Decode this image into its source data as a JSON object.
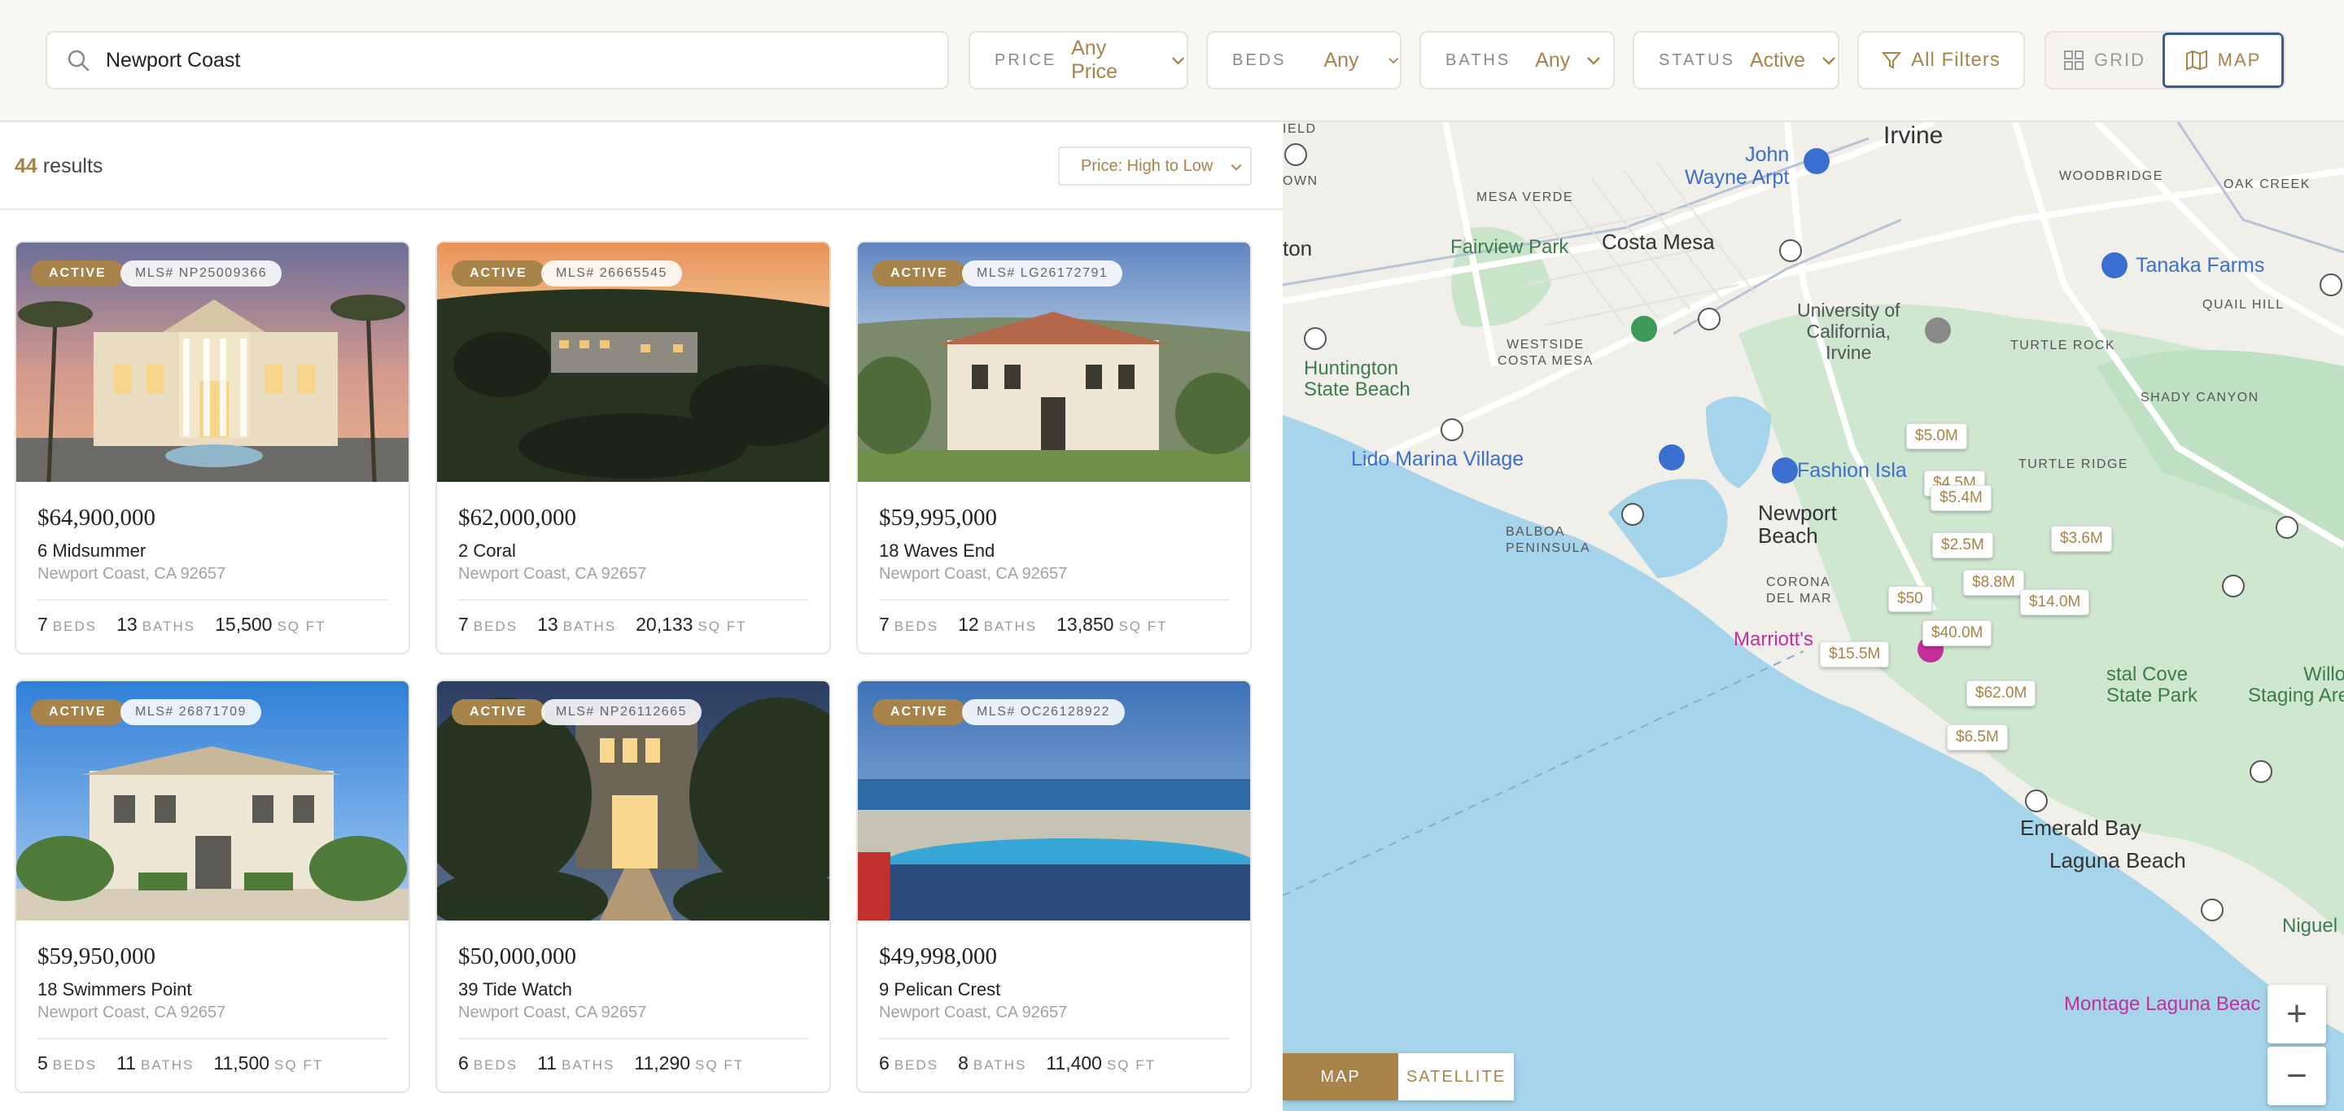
{
  "search": {
    "value": "Newport Coast"
  },
  "filters": {
    "price": {
      "label": "PRICE",
      "value": "Any Price"
    },
    "beds": {
      "label": "BEDS",
      "value": "Any"
    },
    "baths": {
      "label": "BATHS",
      "value": "Any"
    },
    "status": {
      "label": "STATUS",
      "value": "Active"
    },
    "all_filters": "All Filters"
  },
  "view_toggle": {
    "grid": "GRID",
    "map": "MAP",
    "selected": "MAP"
  },
  "results": {
    "count": "44",
    "label": "results",
    "sort": "Price: High to Low"
  },
  "listings": [
    {
      "status": "ACTIVE",
      "mls": "MLS# NP25009366",
      "price": "$64,900,000",
      "address": "6 Midsummer",
      "city": "Newport Coast, CA 92657",
      "beds": "7",
      "baths": "13",
      "sqft": "15,500"
    },
    {
      "status": "ACTIVE",
      "mls": "MLS# 26665545",
      "price": "$62,000,000",
      "address": "2 Coral",
      "city": "Newport Coast, CA 92657",
      "beds": "7",
      "baths": "13",
      "sqft": "20,133"
    },
    {
      "status": "ACTIVE",
      "mls": "MLS# LG26172791",
      "price": "$59,995,000",
      "address": "18 Waves End",
      "city": "Newport Coast, CA 92657",
      "beds": "7",
      "baths": "12",
      "sqft": "13,850"
    },
    {
      "status": "ACTIVE",
      "mls": "MLS# 26871709",
      "price": "$59,950,000",
      "address": "18 Swimmers Point",
      "city": "Newport Coast, CA 92657",
      "beds": "5",
      "baths": "11",
      "sqft": "11,500"
    },
    {
      "status": "ACTIVE",
      "mls": "MLS# NP26112665",
      "price": "$50,000,000",
      "address": "39 Tide Watch",
      "city": "Newport Coast, CA 92657",
      "beds": "6",
      "baths": "11",
      "sqft": "11,290"
    },
    {
      "status": "ACTIVE",
      "mls": "MLS# OC26128922",
      "price": "$49,998,000",
      "address": "9 Pelican Crest",
      "city": "Newport Coast, CA 92657",
      "beds": "6",
      "baths": "8",
      "sqft": "11,400"
    }
  ],
  "units": {
    "beds": "BEDS",
    "baths": "BATHS",
    "sqft": "SQ FT"
  },
  "map": {
    "places": {
      "irvine": "Irvine",
      "costa_mesa": "Costa Mesa",
      "newport_beach": "Newport\nBeach",
      "laguna_beach": "Laguna Beach",
      "emerald_bay": "Emerald Bay",
      "john_wayne": "John\nWayne Arpt",
      "tanaka": "Tanaka Farms",
      "uci": "University of\nCalifornia,\nIrvine",
      "fairview": "Fairview Park",
      "huntington": "Huntington\nState Beach",
      "lido": "Lido Marina Village",
      "fashion": "Fashion Isla",
      "crystal": "stal Cove\nState Park",
      "willow": "Willow\nStaging Area",
      "marriott": "Marriott's",
      "montage": "Montage Laguna Beac",
      "niguel": "Niguel Bo",
      "mesa_verde": "MESA VERDE",
      "westside": "WESTSIDE\nCOSTA MESA",
      "balboa": "BALBOA\nPENINSULA",
      "corona": "CORONA\nDEL MAR",
      "woodbridge": "WOODBRIDGE",
      "oak_creek": "OAK CREEK",
      "quail_hill": "QUAIL HILL",
      "turtle_rock": "TURTLE ROCK",
      "shady_canyon": "SHADY CANYON",
      "turtle_ridge": "TURTLE RIDGE",
      "field": "IELD",
      "town": "OWN",
      "ton": "ton"
    },
    "price_pins": [
      "$5.0M",
      "$4.5M",
      "$5.4M",
      "$2.5M",
      "$3.6M",
      "$8.8M",
      "$14.0M",
      "$40.0M",
      "$15.5M",
      "$62.0M",
      "$6.5M",
      "$50"
    ],
    "type_toggle": {
      "map": "MAP",
      "satellite": "SATELLITE",
      "selected": "MAP"
    },
    "zoom_in": "+",
    "zoom_out": "−"
  },
  "colors": {
    "accent": "#a8834a",
    "water": "#a6d4ea",
    "park": "#c8e6cc",
    "road": "#ffffff",
    "selected_border": "#3b5a96"
  }
}
